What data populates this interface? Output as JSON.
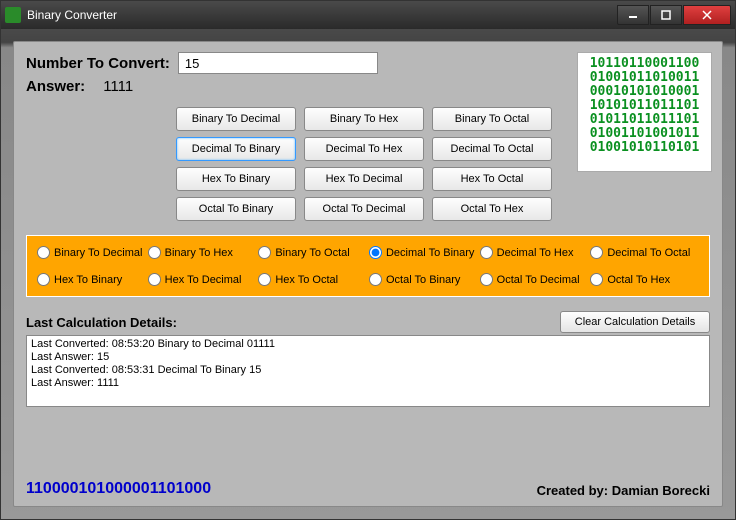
{
  "titlebar": {
    "title": "Binary Converter"
  },
  "labels": {
    "numberToConvert": "Number To Convert:",
    "answer": "Answer:",
    "details": "Last Calculation Details:"
  },
  "input": {
    "value": "15"
  },
  "answer": "1111",
  "binart": "10110110001100\n01001011010011\n00010101010001\n10101011011101\n01011011011101\n01001101001011\n01001010110101",
  "buttons": {
    "r0c0": "Binary To Decimal",
    "r0c1": "Binary To Hex",
    "r0c2": "Binary To Octal",
    "r1c0": "Decimal To Binary",
    "r1c1": "Decimal To Hex",
    "r1c2": "Decimal To Octal",
    "r2c0": "Hex To Binary",
    "r2c1": "Hex To Decimal",
    "r2c2": "Hex To Octal",
    "r3c0": "Octal To Binary",
    "r3c1": "Octal To Decimal",
    "r3c2": "Octal To Hex"
  },
  "radios": {
    "r0": "Binary To Decimal",
    "r1": "Binary To Hex",
    "r2": "Binary To Octal",
    "r3": "Decimal To Binary",
    "r4": "Decimal To Hex",
    "r5": "Decimal To Octal",
    "r6": "Hex To Binary",
    "r7": "Hex To Decimal",
    "r8": "Hex To Octal",
    "r9": "Octal To Binary",
    "r10": "Octal To Decimal",
    "r11": "Octal To Hex"
  },
  "clear": "Clear Calculation Details",
  "details": {
    "line1": "Last Converted: 08:53:20  Binary to Decimal 01111",
    "line2": "Last Answer: 15",
    "line3": "",
    "line4": "Last Converted: 08:53:31  Decimal To Binary 15",
    "line5": "Last Answer: 1111"
  },
  "bottombin": "110000101000001101000",
  "credit": "Created by: Damian Borecki"
}
